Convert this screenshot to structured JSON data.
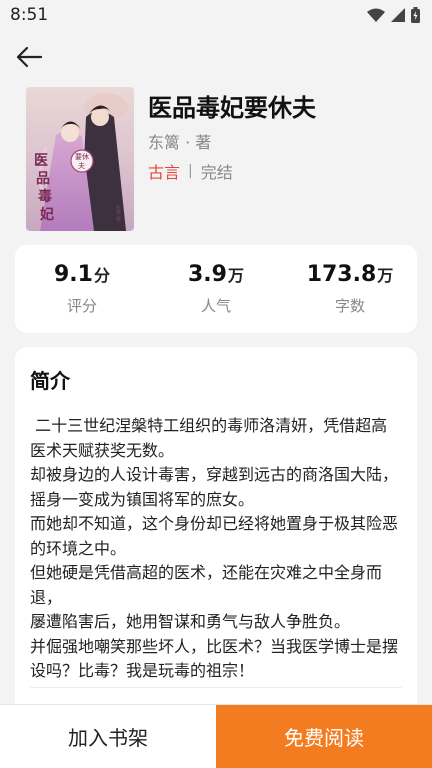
{
  "status_bar": {
    "time": "8:51",
    "icons": [
      "wifi-icon",
      "signal-icon",
      "battery-icon"
    ]
  },
  "header": {
    "back_icon": "arrow-left-icon"
  },
  "book": {
    "title": "医品毒妃要休夫",
    "author": "东篱 · 著",
    "genre": "古言",
    "separator": "|",
    "status": "完结",
    "cover_text": "医品毒妃要休夫"
  },
  "stats": [
    {
      "value": "9.1",
      "unit": "分",
      "label": "评分"
    },
    {
      "value": "3.9",
      "unit": "万",
      "label": "人气"
    },
    {
      "value": "173.8",
      "unit": "万",
      "label": "字数"
    }
  ],
  "intro": {
    "title": "简介",
    "text": " 二十三世纪涅槃特工组织的毒师洛清妍，凭借超高医术天赋获奖无数。\n却被身边的人设计毒害，穿越到远古的商洛国大陆，摇身一变成为镇国将军的庶女。\n而她却不知道，这个身份却已经将她置身于极其险恶的环境之中。\n但她硬是凭借高超的医术，还能在灾难之中全身而退，\n屡遭陷害后，她用智谋和勇气与敌人争胜负。\n并倔强地嘲笑那些坏人，比医术？当我医学博士是摆设吗？比毒？我是玩毒的祖宗！"
  },
  "actions": {
    "add_shelf": "加入书架",
    "read_free": "免费阅读"
  },
  "colors": {
    "accent": "#f47c20",
    "genre": "#e8443a",
    "background": "#f3f3f3"
  }
}
